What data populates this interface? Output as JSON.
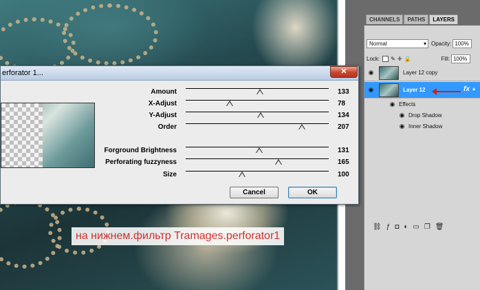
{
  "dialog": {
    "title": "erforator 1...",
    "close_label": "✕",
    "params": [
      {
        "label": "Amount",
        "value": "133",
        "level": 133
      },
      {
        "label": "X-Adjust",
        "value": "78",
        "level": 78
      },
      {
        "label": "Y-Adjust",
        "value": "134",
        "level": 134
      },
      {
        "label": "Order",
        "value": "207",
        "level": 207
      },
      {
        "label": "Forground Brightness",
        "value": "131",
        "level": 131
      },
      {
        "label": "Perforating fuzzyness",
        "value": "165",
        "level": 165
      },
      {
        "label": "Size",
        "value": "100",
        "level": 100
      }
    ],
    "cancel_label": "Cancel",
    "ok_label": "OK"
  },
  "caption": "на нижнем.фильтр Tramages.perforator1",
  "layers_panel": {
    "tabs": [
      "CHANNELS",
      "PATHS",
      "LAYERS"
    ],
    "active_tab": "LAYERS",
    "blend_mode": "Normal",
    "opacity_label": "Opacity:",
    "opacity_value": "100%",
    "lock_label": "Lock:",
    "fill_label": "Fill:",
    "fill_value": "100%",
    "layers": [
      {
        "name": "Layer 12 copy",
        "selected": false,
        "fx": ""
      },
      {
        "name": "Layer 12",
        "selected": true,
        "fx": "fx"
      }
    ],
    "effects_label": "Effects",
    "effects": [
      "Drop Shadow",
      "Inner Shadow"
    ]
  },
  "colors": {
    "accent": "#3399ff",
    "caption_text": "#d03030",
    "arrow": "#c8261c"
  }
}
